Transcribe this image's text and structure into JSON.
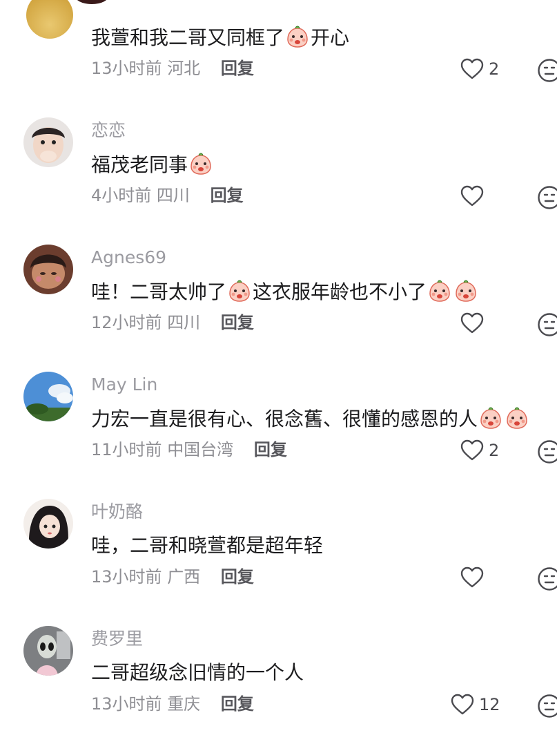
{
  "comments": [
    {
      "user": "",
      "text": "我萱和我二哥又同框了",
      "emoji_tail": "开心",
      "time": "13小时前",
      "region": "河北",
      "reply": "回复",
      "likes": "2"
    },
    {
      "user": "恋恋",
      "text": "福茂老同事",
      "time": "4小时前",
      "region": "四川",
      "reply": "回复",
      "likes": ""
    },
    {
      "user": "Agnes69",
      "text_a": "哇！二哥太帅了",
      "text_b": "这衣服年龄也不小了",
      "time": "12小时前",
      "region": "四川",
      "reply": "回复",
      "likes": ""
    },
    {
      "user": "May Lin",
      "text": "力宏一直是很有心、很念舊、很懂的感恩的人",
      "time": "11小时前",
      "region": "中国台湾",
      "reply": "回复",
      "likes": "2"
    },
    {
      "user": "叶奶酪",
      "text": "哇，二哥和晓萱都是超年轻",
      "time": "13小时前",
      "region": "广西",
      "reply": "回复",
      "likes": ""
    },
    {
      "user": "费罗里",
      "text": "二哥超级念旧情的一个人",
      "time": "13小时前",
      "region": "重庆",
      "reply": "回复",
      "likes": "12"
    }
  ],
  "icons": {
    "like": "heart-outline-icon",
    "more": "emoji-face-icon"
  },
  "colors": {
    "text": "#1c1c1e",
    "username": "#9b9ba1",
    "meta": "#8e8e93",
    "reply": "#57575c"
  }
}
